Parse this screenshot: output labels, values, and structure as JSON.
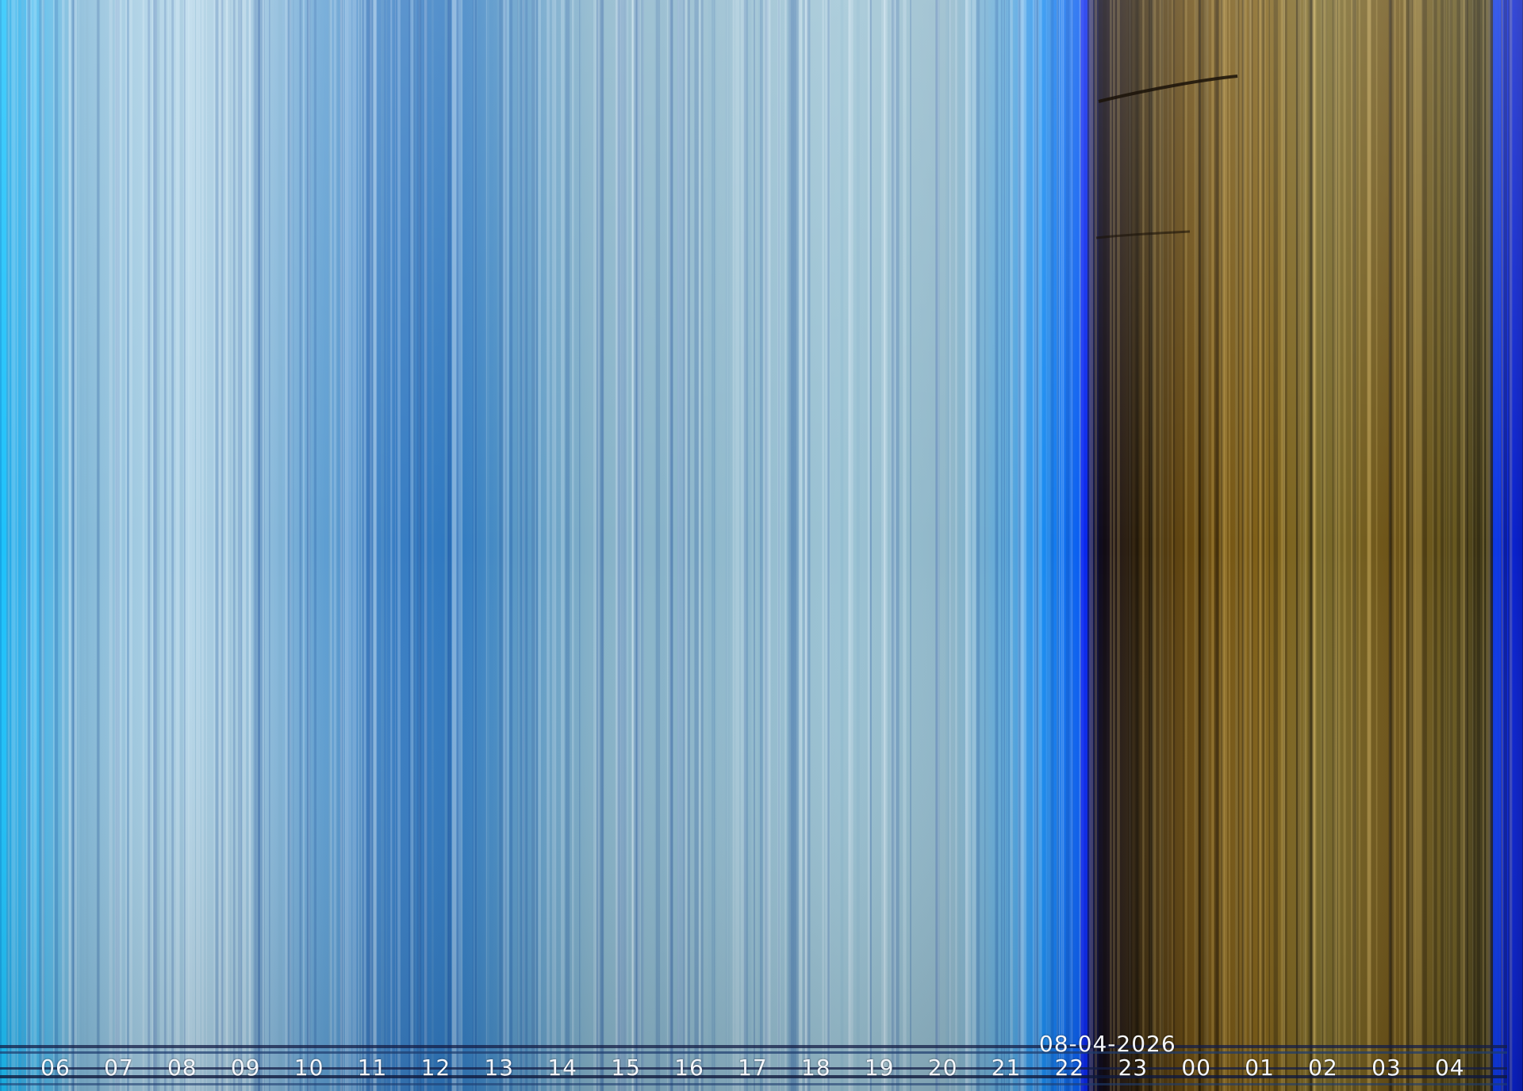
{
  "keogram": {
    "date": "08-04-2026",
    "hours": [
      "06",
      "07",
      "08",
      "09",
      "10",
      "11",
      "12",
      "13",
      "14",
      "15",
      "16",
      "17",
      "18",
      "19",
      "20",
      "21",
      "22",
      "23",
      "00",
      "01",
      "02",
      "03",
      "04"
    ],
    "colors": {
      "day_sky": "#8fb6cc",
      "deep_blue": "#1f64b0",
      "twilight_blue": "#0a2cff",
      "night_gold": "#7a5a12",
      "label_text": "#f4f6fa"
    }
  }
}
